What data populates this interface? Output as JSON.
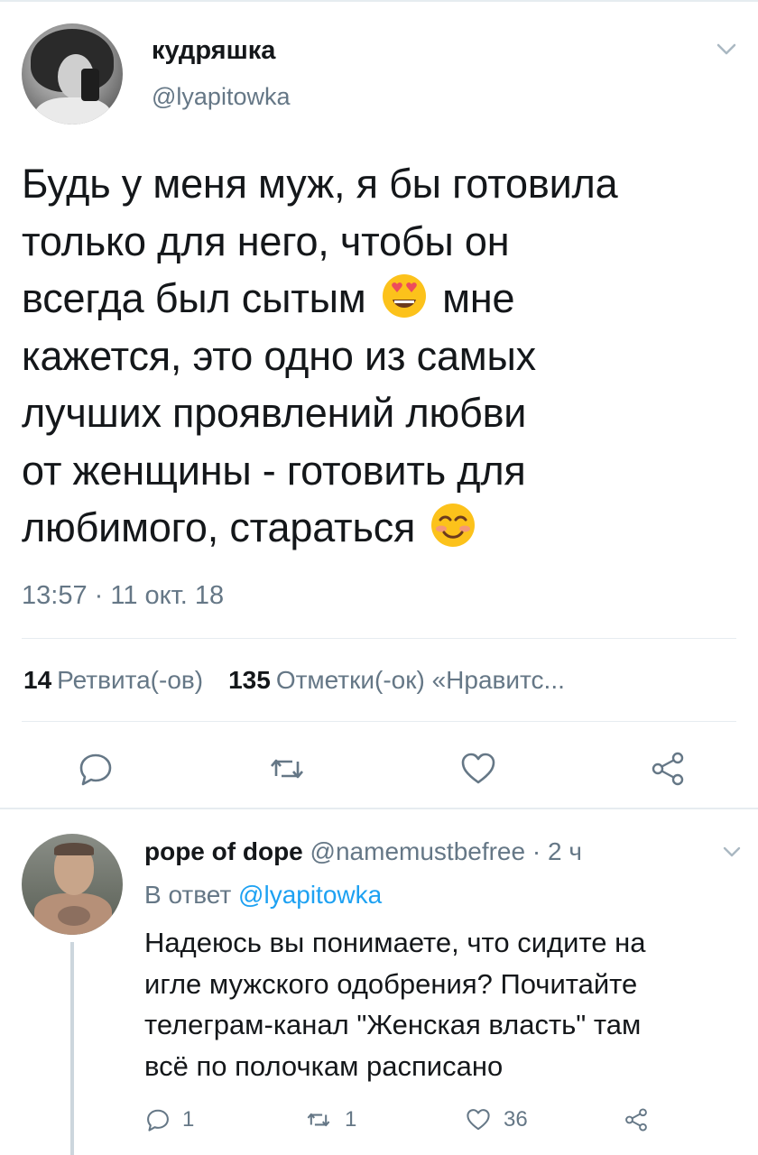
{
  "tweet": {
    "author_name": "кудряшка",
    "author_handle": "@lyapitowka",
    "text_line1": "Будь у меня муж, я бы готовила",
    "text_line2": "только для него, чтобы он",
    "text_line3a": "всегда был сытым",
    "text_line3b": "мне",
    "text_line4": "кажется, это одно из самых",
    "text_line5": "лучших проявлений любви",
    "text_line6": "от женщины - готовить для",
    "text_line7": "любимого, стараться",
    "emoji1": "heart-eyes-emoji",
    "emoji2": "smiling-blush-emoji",
    "timestamp": "13:57 · 11 окт. 18",
    "retweets_count": "14",
    "retweets_label": "Ретвита(-ов)",
    "likes_count": "135",
    "likes_label": "Отметки(-ок) «Нравитс..."
  },
  "actions": {
    "reply_icon": "reply-icon",
    "retweet_icon": "retweet-icon",
    "like_icon": "heart-icon",
    "share_icon": "share-icon"
  },
  "reply": {
    "author_name": "pope of dope",
    "meta": "@namemustbefree · 2 ч",
    "replying_to_prefix": "В ответ",
    "replying_to_mention": "@lyapitowka",
    "text_line1": "Надеюсь вы понимаете, что сидите на",
    "text_line2": "игле мужского одобрения? Почитайте",
    "text_line3": "телеграм-канал \"Женская власть\" там",
    "text_line4": "всё по полочкам расписано",
    "reply_count": "1",
    "retweet_count": "1",
    "like_count": "36"
  },
  "colors": {
    "text": "#14171a",
    "muted": "#657786",
    "link": "#1da1f2",
    "divider": "#e6ecf0"
  }
}
